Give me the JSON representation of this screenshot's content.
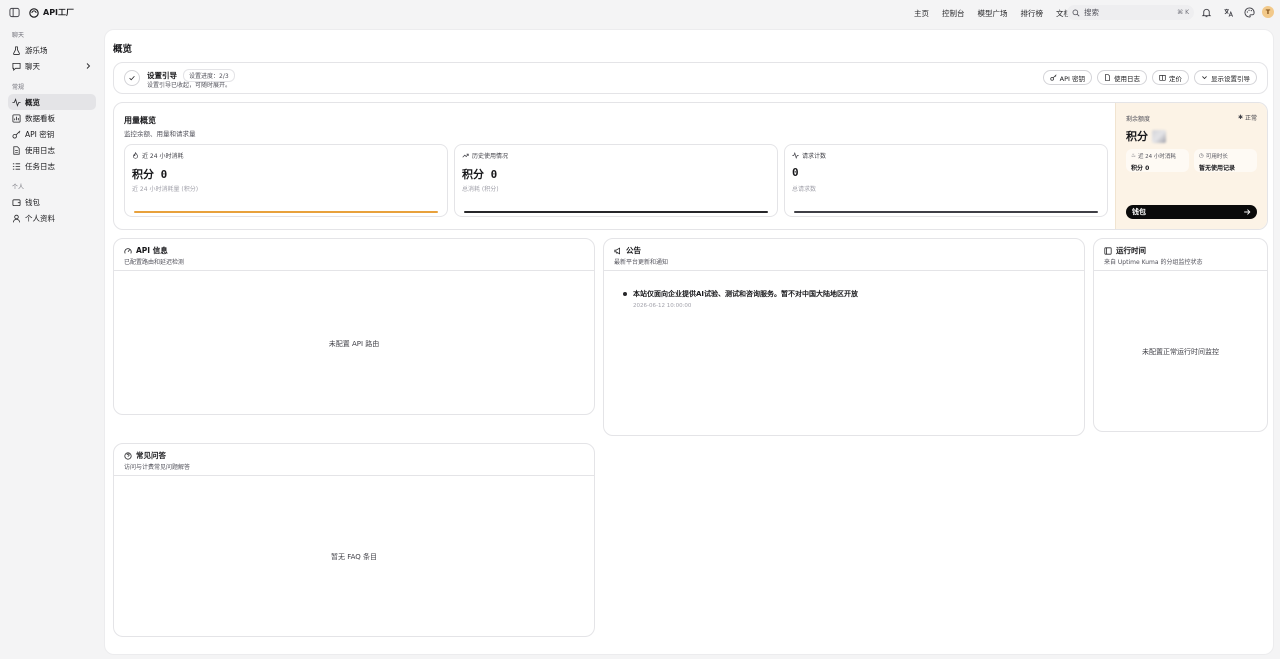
{
  "header": {
    "logo_text": "API工厂",
    "nav": [
      "主页",
      "控制台",
      "模型广场",
      "排行榜",
      "文档"
    ],
    "search_placeholder": "搜索",
    "search_shortcut": "⌘ K",
    "avatar_letter": "T"
  },
  "sidebar": {
    "groups": [
      {
        "label": "聊天",
        "items": [
          {
            "label": "游乐场",
            "icon": "flask-icon"
          },
          {
            "label": "聊天",
            "icon": "message-icon"
          }
        ]
      },
      {
        "label": "常规",
        "items": [
          {
            "label": "概览",
            "icon": "activity-icon"
          },
          {
            "label": "数据看板",
            "icon": "dashboard-icon"
          },
          {
            "label": "API 密钥",
            "icon": "key-icon"
          },
          {
            "label": "使用日志",
            "icon": "file-icon"
          },
          {
            "label": "任务日志",
            "icon": "list-icon"
          }
        ]
      },
      {
        "label": "个人",
        "items": [
          {
            "label": "钱包",
            "icon": "wallet-icon"
          },
          {
            "label": "个人资料",
            "icon": "user-icon"
          }
        ]
      }
    ],
    "active": "概览"
  },
  "page": {
    "title": "概览"
  },
  "guide": {
    "title": "设置引导",
    "progress": "设置进度：2/3",
    "desc": "设置引导已收起，可随时展开。",
    "buttons": [
      "API 密钥",
      "使用日志",
      "定价",
      "显示设置引导"
    ]
  },
  "usage": {
    "title": "用量概览",
    "desc": "监控余额、用量和请求量",
    "stats": [
      {
        "label": "近 24 小时消耗",
        "value": "积分 0",
        "sub": "近 24 小时消耗量 (积分)",
        "bar_color": "#e8a13c"
      },
      {
        "label": "历史使用情况",
        "value": "积分 0",
        "sub": "总消耗 (积分)",
        "bar_color": "#27272a"
      },
      {
        "label": "请求计数",
        "value": "0",
        "sub": "总请求数",
        "bar_color": "#3f3f46"
      }
    ]
  },
  "quota": {
    "label": "剩余额度",
    "status": "正常",
    "value": "积分",
    "box1_label": "近 24 小时消耗",
    "box1_value": "积分 0",
    "box2_label": "可用时长",
    "box2_value": "暂无使用记录",
    "wallet_button": "钱包"
  },
  "api_info": {
    "title": "API 信息",
    "desc": "已配置路由和延迟检测",
    "empty": "未配置 API 路由"
  },
  "notice": {
    "title": "公告",
    "desc": "最新平台更新和通知",
    "items": [
      {
        "text": "本站仅面向企业提供AI试验、测试和咨询服务。暂不对中国大陆地区开放",
        "date": "2026-06-12 10:00:00"
      }
    ]
  },
  "uptime": {
    "title": "运行时间",
    "desc": "来自 Uptime Kuma 的分组监控状态",
    "empty": "未配置正常运行时间监控"
  },
  "faq": {
    "title": "常见问答",
    "desc": "访问与计费常见问题解答",
    "empty": "暂无 FAQ 条目"
  }
}
